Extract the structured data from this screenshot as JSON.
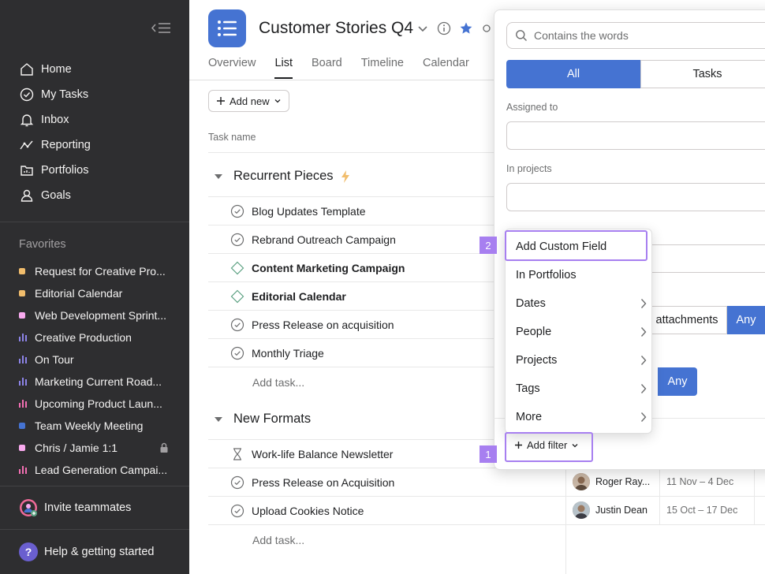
{
  "sidebar": {
    "nav": [
      {
        "label": "Home",
        "icon": "home-icon"
      },
      {
        "label": "My Tasks",
        "icon": "check-circle-icon"
      },
      {
        "label": "Inbox",
        "icon": "bell-icon"
      },
      {
        "label": "Reporting",
        "icon": "trend-line-icon"
      },
      {
        "label": "Portfolios",
        "icon": "folder-chart-icon"
      },
      {
        "label": "Goals",
        "icon": "person-icon"
      }
    ],
    "favorites_title": "Favorites",
    "favorites": [
      {
        "label": "Request for Creative Pro...",
        "marker": "dot",
        "color": "#f1bd6c"
      },
      {
        "label": "Editorial Calendar",
        "marker": "dot",
        "color": "#f1bd6c"
      },
      {
        "label": "Web Development Sprint...",
        "marker": "dot",
        "color": "#f9aaef"
      },
      {
        "label": "Creative Production",
        "marker": "bars",
        "color": "#8d84e8"
      },
      {
        "label": "On Tour",
        "marker": "bars",
        "color": "#8d84e8"
      },
      {
        "label": "Marketing Current Road...",
        "marker": "bars",
        "color": "#8d84e8"
      },
      {
        "label": "Upcoming Product Laun...",
        "marker": "bars",
        "color": "#f26fb2"
      },
      {
        "label": "Team Weekly Meeting",
        "marker": "dot",
        "color": "#4573d2"
      },
      {
        "label": "Chris / Jamie 1:1",
        "marker": "dot",
        "color": "#f9aaef"
      },
      {
        "label": "Lead Generation Campai...",
        "marker": "bars",
        "color": "#f26fb2"
      }
    ],
    "invite": "Invite teammates",
    "help": "Help & getting started"
  },
  "project": {
    "title": "Customer Stories Q4",
    "tabs": [
      "Overview",
      "List",
      "Board",
      "Timeline",
      "Calendar"
    ],
    "active_tab": "List",
    "add_new": "Add new",
    "column_task_name": "Task name"
  },
  "sections": [
    {
      "title": "Recurrent Pieces",
      "tasks": [
        {
          "name": "Blog Updates Template",
          "icon": "check-circle-icon",
          "bold": false
        },
        {
          "name": "Rebrand Outreach Campaign",
          "icon": "check-circle-icon",
          "bold": false
        },
        {
          "name": "Content Marketing Campaign",
          "icon": "diamond-icon",
          "bold": true
        },
        {
          "name": "Editorial Calendar",
          "icon": "diamond-icon",
          "bold": true
        },
        {
          "name": "Press Release on acquisition",
          "icon": "check-circle-icon",
          "bold": false
        },
        {
          "name": "Monthly Triage",
          "icon": "check-circle-icon",
          "bold": false
        }
      ],
      "add_task": "Add task..."
    },
    {
      "title": "New Formats",
      "tasks": [
        {
          "name": "Work-life Balance Newsletter",
          "icon": "hourglass-icon",
          "bold": false
        },
        {
          "name": "Press Release on Acquisition",
          "icon": "check-circle-icon",
          "bold": false,
          "assignee": "Roger Ray...",
          "dates": "11 Nov – 4 Dec"
        },
        {
          "name": "Upload Cookies Notice",
          "icon": "check-circle-icon",
          "bold": false,
          "assignee": "Justin Dean",
          "dates": "15 Oct – 17 Dec"
        }
      ],
      "add_task": "Add task..."
    }
  ],
  "filter_panel": {
    "search_placeholder": "Contains the words",
    "seg_all": "All",
    "seg_tasks": "Tasks",
    "assigned_to": "Assigned to",
    "in_projects": "In projects",
    "attachments": "attachments",
    "any": "Any",
    "any2": "Any",
    "add_filter": "Add filter"
  },
  "menu": {
    "items": [
      {
        "label": "Add Custom Field",
        "submenu": false
      },
      {
        "label": "In Portfolios",
        "submenu": false
      },
      {
        "label": "Dates",
        "submenu": true
      },
      {
        "label": "People",
        "submenu": true
      },
      {
        "label": "Projects",
        "submenu": true
      },
      {
        "label": "Tags",
        "submenu": true
      },
      {
        "label": "More",
        "submenu": true
      }
    ]
  },
  "annotations": {
    "badge1": "1",
    "badge2": "2",
    "color": "#a77ff0"
  },
  "colors": {
    "accent": "#4573d2",
    "sidebar_bg": "#2e2e30"
  }
}
